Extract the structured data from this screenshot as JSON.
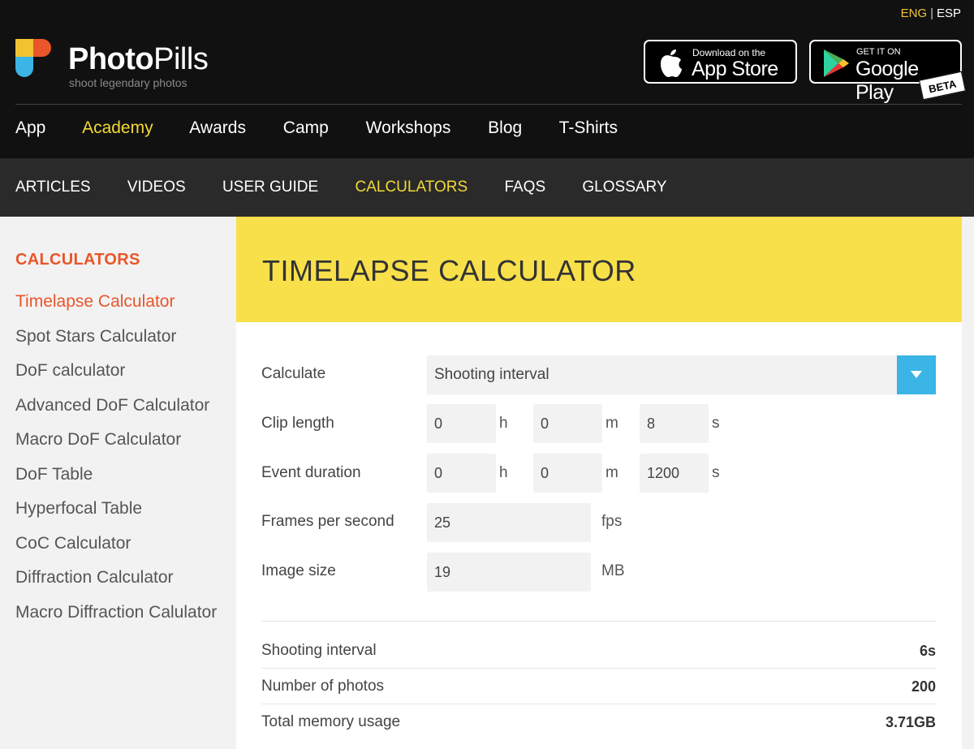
{
  "language": {
    "active": "ENG",
    "separator": "|",
    "other": "ESP"
  },
  "brand": {
    "name_bold": "Photo",
    "name_regular": "Pills",
    "tagline": "shoot legendary photos"
  },
  "stores": {
    "appstore": {
      "small": "Download on the",
      "big": "App Store"
    },
    "googleplay": {
      "small": "GET IT ON",
      "big": "Google Play",
      "badge": "BETA"
    }
  },
  "main_nav": [
    {
      "label": "App",
      "active": false
    },
    {
      "label": "Academy",
      "active": true
    },
    {
      "label": "Awards",
      "active": false
    },
    {
      "label": "Camp",
      "active": false
    },
    {
      "label": "Workshops",
      "active": false
    },
    {
      "label": "Blog",
      "active": false
    },
    {
      "label": "T-Shirts",
      "active": false
    }
  ],
  "sub_nav": [
    {
      "label": "ARTICLES",
      "active": false
    },
    {
      "label": "VIDEOS",
      "active": false
    },
    {
      "label": "USER GUIDE",
      "active": false
    },
    {
      "label": "CALCULATORS",
      "active": true
    },
    {
      "label": "FAQS",
      "active": false
    },
    {
      "label": "GLOSSARY",
      "active": false
    }
  ],
  "sidebar": {
    "title": "CALCULATORS",
    "items": [
      {
        "label": "Timelapse Calculator",
        "active": true
      },
      {
        "label": "Spot Stars Calculator",
        "active": false
      },
      {
        "label": "DoF calculator",
        "active": false
      },
      {
        "label": "Advanced DoF Calculator",
        "active": false
      },
      {
        "label": "Macro DoF Calculator",
        "active": false
      },
      {
        "label": "DoF Table",
        "active": false
      },
      {
        "label": "Hyperfocal Table",
        "active": false
      },
      {
        "label": "CoC Calculator",
        "active": false
      },
      {
        "label": "Diffraction Calculator",
        "active": false
      },
      {
        "label": "Macro Diffraction Calulator",
        "active": false
      }
    ]
  },
  "calculator": {
    "title": "TIMELAPSE CALCULATOR",
    "calculate_label": "Calculate",
    "calculate_value": "Shooting interval",
    "clip_length": {
      "label": "Clip length",
      "h": "0",
      "m": "0",
      "s": "8"
    },
    "event_duration": {
      "label": "Event duration",
      "h": "0",
      "m": "0",
      "s": "1200"
    },
    "fps": {
      "label": "Frames per second",
      "value": "25",
      "unit": "fps"
    },
    "image_size": {
      "label": "Image size",
      "value": "19",
      "unit": "MB"
    },
    "units": {
      "h": "h",
      "m": "m",
      "s": "s"
    },
    "results": [
      {
        "label": "Shooting interval",
        "value": "6s"
      },
      {
        "label": "Number of photos",
        "value": "200"
      },
      {
        "label": "Total memory usage",
        "value": "3.71GB"
      }
    ]
  },
  "colors": {
    "accent_orange": "#e8562a",
    "accent_yellow": "#f2d936",
    "banner_yellow": "#f8e04a",
    "dropdown_blue": "#3ab5e6"
  }
}
